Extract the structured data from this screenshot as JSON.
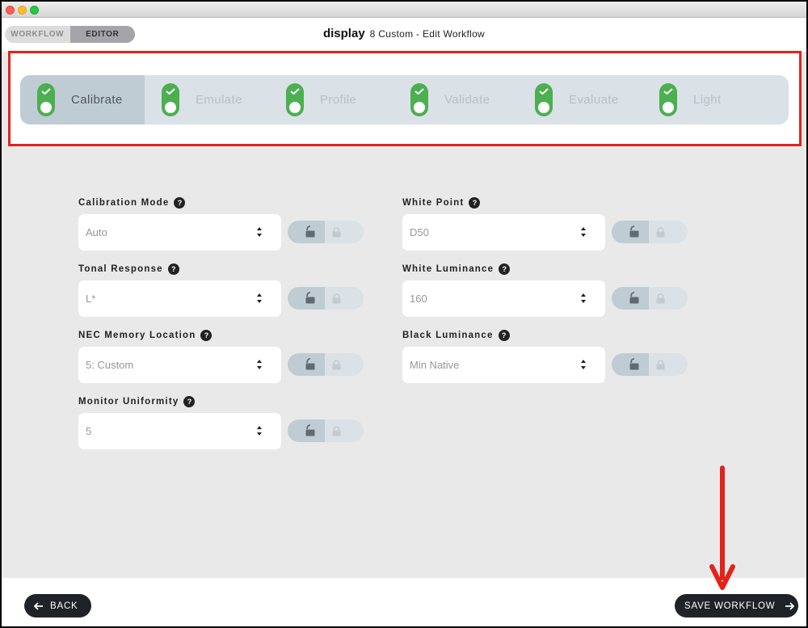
{
  "header": {
    "mode_tabs": [
      "WORKFLOW",
      "EDITOR"
    ],
    "active_mode": "EDITOR",
    "title": "display",
    "subtitle": "8 Custom - Edit Workflow"
  },
  "steps": [
    {
      "label": "Calibrate",
      "active": true
    },
    {
      "label": "Emulate",
      "active": false
    },
    {
      "label": "Profile",
      "active": false
    },
    {
      "label": "Validate",
      "active": false
    },
    {
      "label": "Evaluate",
      "active": false
    },
    {
      "label": "Light",
      "active": false
    }
  ],
  "fields": {
    "calibration_mode": {
      "label": "Calibration Mode",
      "value": "Auto"
    },
    "tonal_response": {
      "label": "Tonal Response",
      "value": "L*"
    },
    "nec_memory_location": {
      "label": "NEC Memory Location",
      "value": "5: Custom"
    },
    "monitor_uniformity": {
      "label": "Monitor Uniformity",
      "value": "5"
    },
    "white_point": {
      "label": "White Point",
      "value": "D50"
    },
    "white_luminance": {
      "label": "White Luminance",
      "value": "160"
    },
    "black_luminance": {
      "label": "Black Luminance",
      "value": "Min Native"
    }
  },
  "help_glyph": "?",
  "footer": {
    "back_label": "BACK",
    "save_label": "SAVE WORKFLOW"
  },
  "colors": {
    "accent_green": "#4caf50",
    "annotation_red": "#e2231a",
    "button_dark": "#1f2227"
  },
  "icons": {
    "step_status": "check-icon",
    "lock": "unlock-icon / lock-icon",
    "back": "arrow-left-icon",
    "save": "arrow-right-icon"
  }
}
